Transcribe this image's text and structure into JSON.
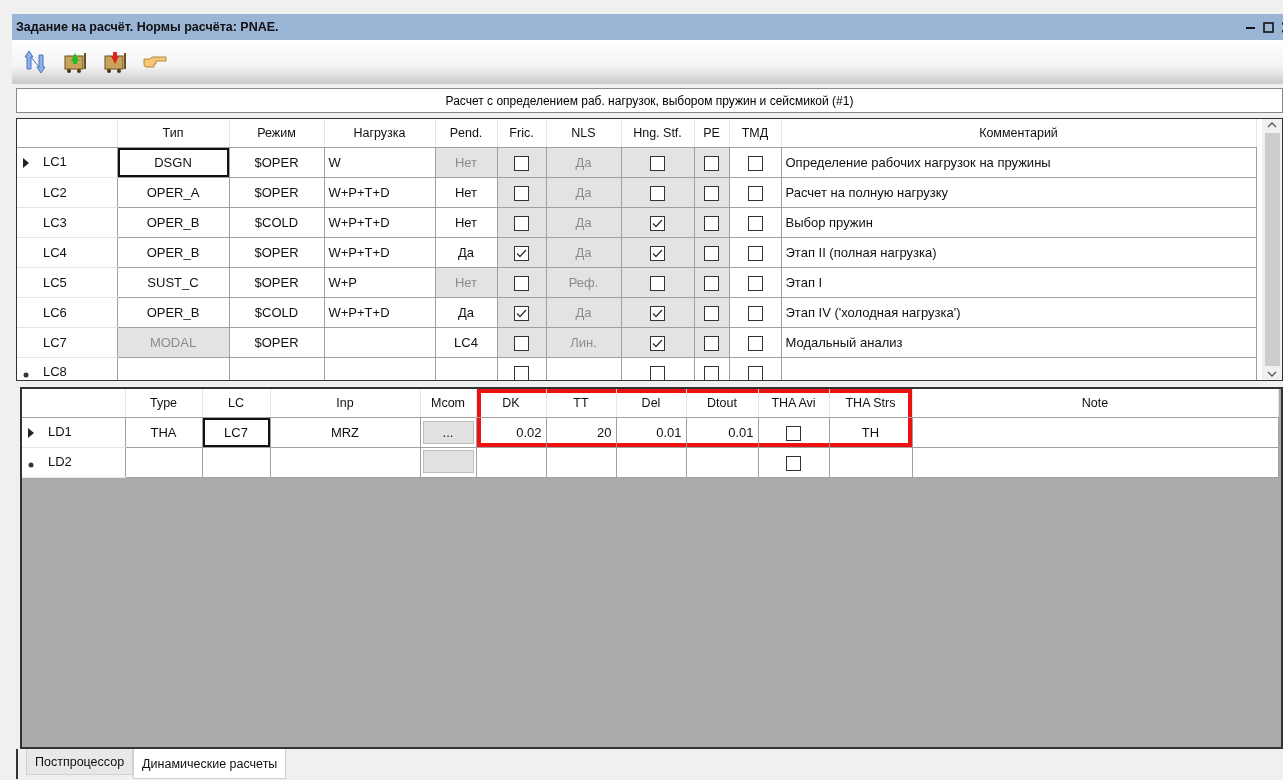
{
  "window": {
    "title": "Задание на расчёт. Нормы расчёта: PNAE."
  },
  "toolbar": [
    {
      "kind": "sort"
    },
    {
      "kind": "add"
    },
    {
      "kind": "remove"
    },
    {
      "kind": "point"
    }
  ],
  "load_cases": {
    "caption": "Расчет с определением раб. нагрузок, выбором пружин и сейсмикой (#1)",
    "columns": [
      "Тип",
      "Режим",
      "Нагрузка",
      "Pend.",
      "Fric.",
      "NLS",
      "Hng. Stf.",
      "PE",
      "ТМД",
      "Комментарий"
    ],
    "rows": [
      {
        "label": "LC1",
        "kind": "current",
        "cells": [
          {
            "kind": "text",
            "text": "DSGN",
            "focused": true
          },
          {
            "kind": "text",
            "text": "$OPER"
          },
          {
            "kind": "text",
            "text": "W"
          },
          {
            "kind": "text",
            "text": "Нет",
            "disabled": true
          },
          {
            "kind": "check",
            "checked": false,
            "disabled": true
          },
          {
            "kind": "text",
            "text": "Да",
            "disabled": true
          },
          {
            "kind": "check",
            "checked": false,
            "disabled": true
          },
          {
            "kind": "check",
            "checked": false,
            "disabled": true
          },
          {
            "kind": "check",
            "checked": false
          },
          {
            "kind": "text",
            "text": "Определение рабочих нагрузок на пружины"
          }
        ]
      },
      {
        "label": "LC2",
        "kind": "normal",
        "cells": [
          {
            "kind": "text",
            "text": "OPER_A"
          },
          {
            "kind": "text",
            "text": "$OPER"
          },
          {
            "kind": "text",
            "text": "W+P+T+D"
          },
          {
            "kind": "text",
            "text": "Нет"
          },
          {
            "kind": "check",
            "checked": false,
            "disabled": true
          },
          {
            "kind": "text",
            "text": "Да",
            "disabled": true
          },
          {
            "kind": "check",
            "checked": false,
            "disabled": true
          },
          {
            "kind": "check",
            "checked": false,
            "disabled": true
          },
          {
            "kind": "check",
            "checked": false
          },
          {
            "kind": "text",
            "text": "Расчет на полную нагрузку"
          }
        ]
      },
      {
        "label": "LC3",
        "kind": "normal",
        "cells": [
          {
            "kind": "text",
            "text": "OPER_B"
          },
          {
            "kind": "text",
            "text": "$COLD"
          },
          {
            "kind": "text",
            "text": "W+P+T+D"
          },
          {
            "kind": "text",
            "text": "Нет"
          },
          {
            "kind": "check",
            "checked": false,
            "disabled": true
          },
          {
            "kind": "text",
            "text": "Да",
            "disabled": true
          },
          {
            "kind": "check",
            "checked": true,
            "disabled": true
          },
          {
            "kind": "check",
            "checked": false,
            "disabled": true
          },
          {
            "kind": "check",
            "checked": false
          },
          {
            "kind": "text",
            "text": "Выбор пружин"
          }
        ]
      },
      {
        "label": "LC4",
        "kind": "normal",
        "cells": [
          {
            "kind": "text",
            "text": "OPER_B"
          },
          {
            "kind": "text",
            "text": "$OPER"
          },
          {
            "kind": "text",
            "text": "W+P+T+D"
          },
          {
            "kind": "text",
            "text": "Да"
          },
          {
            "kind": "check",
            "checked": true,
            "disabled": true
          },
          {
            "kind": "text",
            "text": "Да",
            "disabled": true
          },
          {
            "kind": "check",
            "checked": true,
            "disabled": true
          },
          {
            "kind": "check",
            "checked": false,
            "disabled": true
          },
          {
            "kind": "check",
            "checked": false
          },
          {
            "kind": "text",
            "text": "Этап II (полная нагрузка)"
          }
        ]
      },
      {
        "label": "LC5",
        "kind": "normal",
        "cells": [
          {
            "kind": "text",
            "text": "SUST_C"
          },
          {
            "kind": "text",
            "text": "$OPER"
          },
          {
            "kind": "text",
            "text": "W+P"
          },
          {
            "kind": "text",
            "text": "Нет",
            "disabled": true
          },
          {
            "kind": "check",
            "checked": false,
            "disabled": true
          },
          {
            "kind": "text",
            "text": "Реф.",
            "disabled": true
          },
          {
            "kind": "check",
            "checked": false,
            "disabled": true
          },
          {
            "kind": "check",
            "checked": false,
            "disabled": true
          },
          {
            "kind": "check",
            "checked": false
          },
          {
            "kind": "text",
            "text": "Этап I"
          }
        ]
      },
      {
        "label": "LC6",
        "kind": "normal",
        "cells": [
          {
            "kind": "text",
            "text": "OPER_B"
          },
          {
            "kind": "text",
            "text": "$COLD"
          },
          {
            "kind": "text",
            "text": "W+P+T+D"
          },
          {
            "kind": "text",
            "text": "Да"
          },
          {
            "kind": "check",
            "checked": true,
            "disabled": true
          },
          {
            "kind": "text",
            "text": "Да",
            "disabled": true
          },
          {
            "kind": "check",
            "checked": true,
            "disabled": true
          },
          {
            "kind": "check",
            "checked": false,
            "disabled": true
          },
          {
            "kind": "check",
            "checked": false
          },
          {
            "kind": "text",
            "text": "Этап IV ('холодная нагрузка')"
          }
        ]
      },
      {
        "label": "LC7",
        "kind": "normal",
        "cells": [
          {
            "kind": "text",
            "text": "MODAL",
            "disabled": true
          },
          {
            "kind": "text",
            "text": "$OPER"
          },
          {
            "kind": "blank"
          },
          {
            "kind": "text",
            "text": "LC4"
          },
          {
            "kind": "check",
            "checked": false,
            "disabled": true
          },
          {
            "kind": "text",
            "text": "Лин.",
            "disabled": true
          },
          {
            "kind": "check",
            "checked": true,
            "disabled": true
          },
          {
            "kind": "check",
            "checked": false,
            "disabled": true
          },
          {
            "kind": "check",
            "checked": false
          },
          {
            "kind": "text",
            "text": "Модальный анализ"
          }
        ]
      },
      {
        "label": "LC8",
        "kind": "new",
        "cells": [
          {
            "kind": "blank"
          },
          {
            "kind": "blank"
          },
          {
            "kind": "blank"
          },
          {
            "kind": "blank"
          },
          {
            "kind": "check",
            "checked": false
          },
          {
            "kind": "blank"
          },
          {
            "kind": "check",
            "checked": false
          },
          {
            "kind": "check",
            "checked": false
          },
          {
            "kind": "check",
            "checked": false
          },
          {
            "kind": "blank"
          }
        ]
      }
    ]
  },
  "dynamics": {
    "columns": [
      {
        "label": "Type",
        "highlighted": false
      },
      {
        "label": "LC",
        "highlighted": false
      },
      {
        "label": "Inp",
        "highlighted": false
      },
      {
        "label": "Mcom",
        "highlighted": false
      },
      {
        "label": "DK",
        "highlighted": true
      },
      {
        "label": "TT",
        "highlighted": true
      },
      {
        "label": "Del",
        "highlighted": true
      },
      {
        "label": "Dtout",
        "highlighted": true
      },
      {
        "label": "THA Avi",
        "highlighted": true
      },
      {
        "label": "THA Strs",
        "highlighted": true
      },
      {
        "label": "Note",
        "highlighted": false
      }
    ],
    "rows": [
      {
        "label": "LD1",
        "kind": "current",
        "cells": [
          {
            "kind": "text",
            "text": "THA"
          },
          {
            "kind": "text",
            "text": "LC7",
            "focused": true
          },
          {
            "kind": "text",
            "text": "MRZ"
          },
          {
            "kind": "button",
            "text": "..."
          },
          {
            "kind": "number",
            "text": "0.02"
          },
          {
            "kind": "number",
            "text": "20"
          },
          {
            "kind": "number",
            "text": "0.01"
          },
          {
            "kind": "number",
            "text": "0.01"
          },
          {
            "kind": "check",
            "checked": false
          },
          {
            "kind": "text",
            "text": "TH"
          },
          {
            "kind": "blank"
          }
        ]
      },
      {
        "label": "LD2",
        "kind": "new",
        "cells": [
          {
            "kind": "blank"
          },
          {
            "kind": "blank"
          },
          {
            "kind": "blank"
          },
          {
            "kind": "button"
          },
          {
            "kind": "blank"
          },
          {
            "kind": "blank"
          },
          {
            "kind": "blank"
          },
          {
            "kind": "blank"
          },
          {
            "kind": "check",
            "checked": false
          },
          {
            "kind": "blank"
          },
          {
            "kind": "blank"
          }
        ]
      }
    ]
  },
  "tabs": [
    {
      "label": "Постпроцессор",
      "selected": false
    },
    {
      "label": "Динамические расчеты",
      "selected": true
    }
  ]
}
